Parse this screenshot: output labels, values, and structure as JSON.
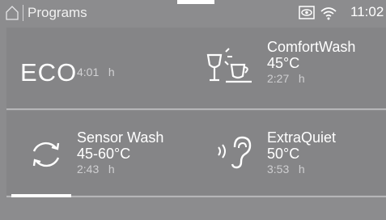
{
  "header": {
    "home_icon": "home-icon",
    "title": "Programs",
    "status_icons": [
      "eye-badge-icon",
      "wifi-icon"
    ],
    "time": "11:02"
  },
  "programs": [
    {
      "name": "ECO",
      "temperature": "",
      "duration": "4:01",
      "unit": "h",
      "icon": "none"
    },
    {
      "name": "ComfortWash",
      "temperature": "45°C",
      "duration": "2:27",
      "unit": "h",
      "icon": "glass-cup-icon"
    },
    {
      "name": "Sensor Wash",
      "temperature": "45-60°C",
      "duration": "2:43",
      "unit": "h",
      "icon": "cycle-arrows-icon"
    },
    {
      "name": "ExtraQuiet",
      "temperature": "50°C",
      "duration": "3:53",
      "unit": "h",
      "icon": "ear-icon"
    }
  ],
  "colors": {
    "background": "#8c8c8e",
    "panel": "#858587",
    "text": "#ffffff",
    "muted": "#cfcfd1"
  }
}
